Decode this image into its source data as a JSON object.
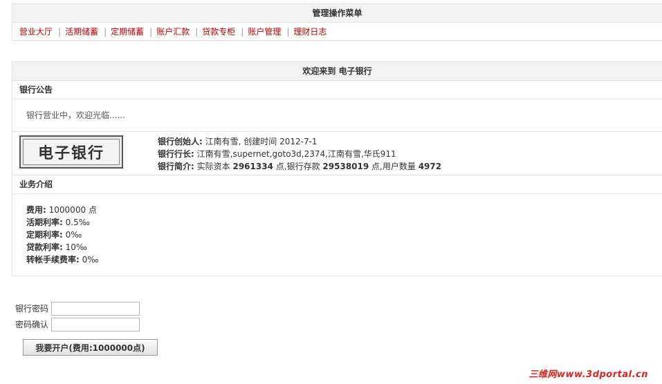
{
  "menu": {
    "title": "管理操作菜单",
    "separator": "|",
    "items": [
      "营业大厅",
      "活期储蓄",
      "定期储蓄",
      "账户汇款",
      "贷款专柜",
      "账户管理",
      "理财日志"
    ]
  },
  "main": {
    "title": "欢迎来到 电子银行",
    "notice_title": "银行公告",
    "notice_text": "银行营业中，欢迎光临......",
    "logo_text": "电子银行",
    "founder_label": "银行创始人:",
    "founder_value": "江南有雪, 创建时间 2012-7-1",
    "president_label": "银行行长:",
    "president_value": "江南有雪,supernet,goto3d,2374,江南有雪,华氏911",
    "intro_label": "银行简介:",
    "intro_prefix": "实际资本",
    "capital": "2961334",
    "intro_mid1": "点,银行存款",
    "deposits": "29538019",
    "intro_mid2": "点,用户数量",
    "users": "4972",
    "business_title": "业务介绍",
    "fees": [
      {
        "label": "费用:",
        "value": "1000000 点"
      },
      {
        "label": "活期利率:",
        "value": "0.5‰"
      },
      {
        "label": "定期利率:",
        "value": "0‰"
      },
      {
        "label": "贷款利率:",
        "value": "10‰"
      },
      {
        "label": "转帐手续费率:",
        "value": "0‰"
      }
    ]
  },
  "form": {
    "password_label": "银行密码",
    "password_value": "",
    "confirm_label": "密码确认",
    "confirm_value": "",
    "submit_label": "我要开户(费用:1000000点)"
  },
  "watermark": "三维网www.3dportal.cn"
}
